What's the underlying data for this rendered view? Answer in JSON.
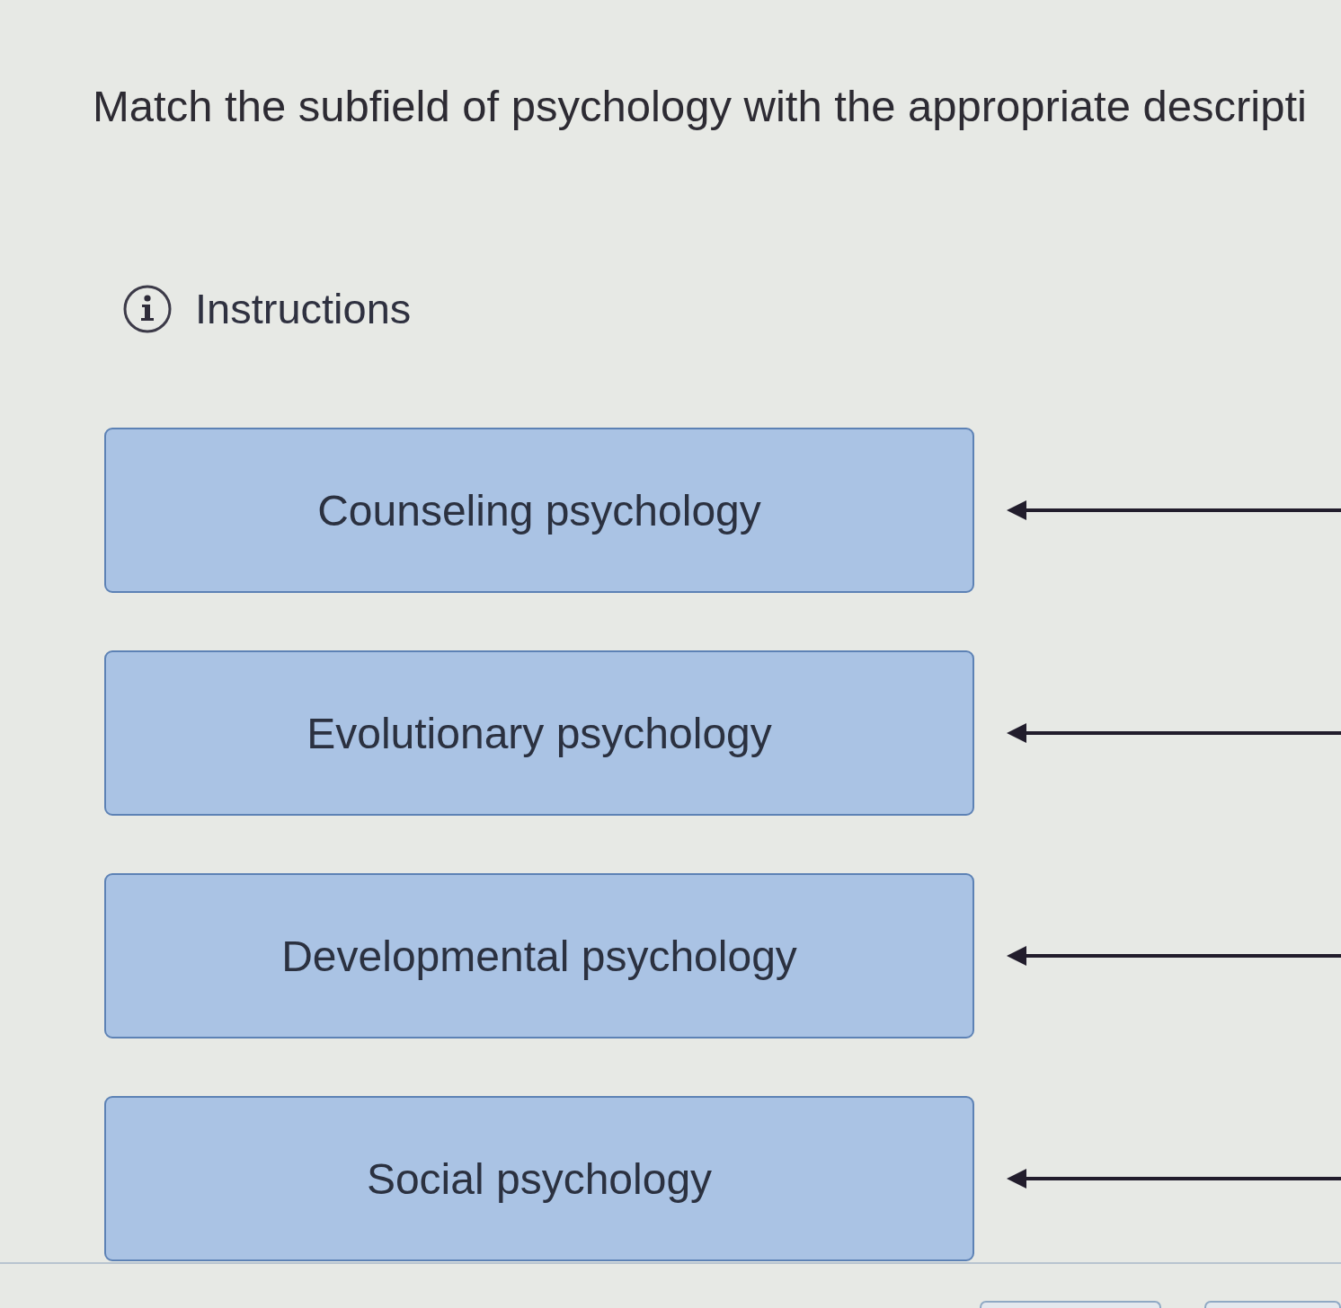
{
  "question": {
    "title": "Match the subfield of psychology with the appropriate descripti"
  },
  "instructions": {
    "label": "Instructions"
  },
  "subfields": [
    {
      "label": "Counseling psychology"
    },
    {
      "label": "Evolutionary psychology"
    },
    {
      "label": "Developmental psychology"
    },
    {
      "label": "Social psychology"
    }
  ]
}
